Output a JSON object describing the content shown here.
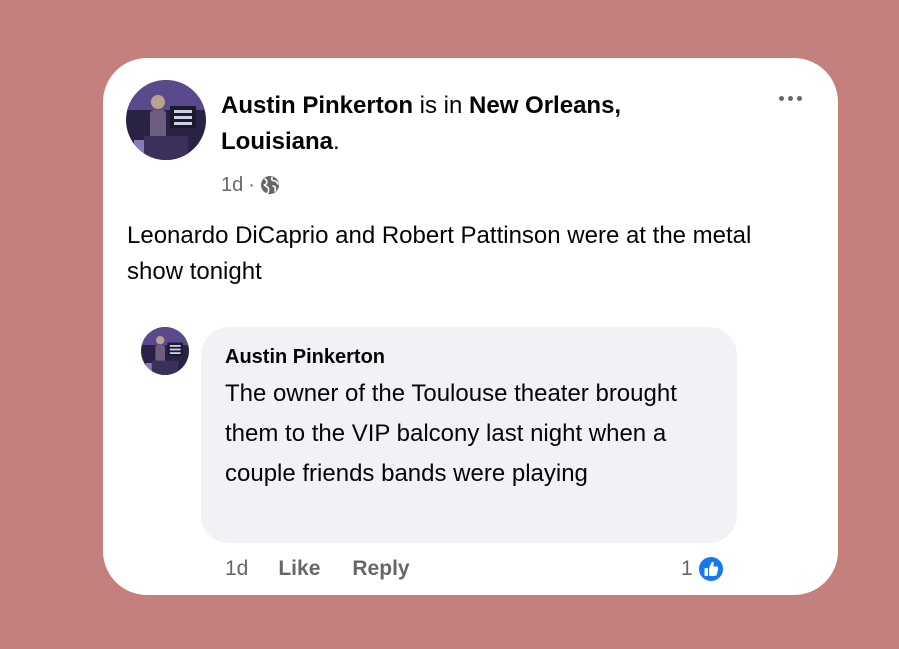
{
  "post": {
    "author": "Austin Pinkerton",
    "connector": " is in ",
    "location": "New Orleans, Louisiana",
    "period": ".",
    "time": "1d",
    "separator": "·",
    "privacy_icon": "globe-icon",
    "more_icon": "more-options-icon",
    "text": "Leonardo DiCaprio and Robert Pattinson were at the metal show tonight"
  },
  "comment": {
    "author": "Austin Pinkerton",
    "text": "The owner of the Toulouse theater brought them to the VIP balcony last night when a couple friends bands were playing",
    "time": "1d",
    "like_label": "Like",
    "reply_label": "Reply",
    "reaction_count": "1",
    "reaction_icon": "like-reaction-icon"
  },
  "colors": {
    "background": "#c4807d",
    "card": "#ffffff",
    "bubble": "#f0f2f5",
    "secondary_text": "#65676b",
    "like_blue": "#1877f2"
  }
}
